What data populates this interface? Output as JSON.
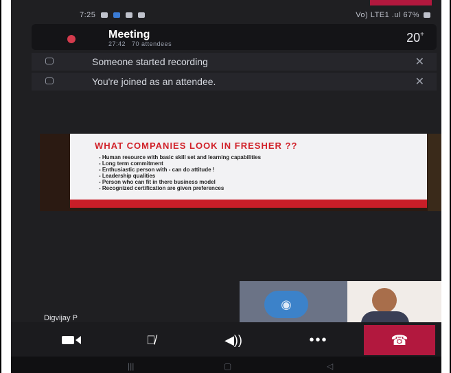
{
  "statusbar": {
    "time": "7:25",
    "right_text": "Vo) LTE1 .ul 67%"
  },
  "meeting": {
    "title": "Meeting",
    "duration": "27:42",
    "attendees": "70 attendees",
    "participant_count": "20",
    "participant_plus": "+"
  },
  "notifications": [
    {
      "text": "Someone started recording"
    },
    {
      "text": "You're joined as an attendee."
    }
  ],
  "slide": {
    "title": "WHAT COMPANIES LOOK IN FRESHER ??",
    "bullets": [
      "Human resource with basic skill set and learning capabilities",
      "Long term commitment",
      "Enthusiastic person with - can do attitude !",
      "Leadership qualities",
      "Person who can fit in there business model",
      "Recognized certification are given preferences"
    ]
  },
  "speaker": {
    "name": "Digvijay P"
  },
  "controls": {
    "camera_icon": "video-camera-off-icon",
    "mic_icon": "mic-off-icon",
    "speaker_icon": "speaker-icon",
    "more_icon": "more-options-icon",
    "hangup_icon": "hang-up-icon"
  },
  "colors": {
    "accent": "#b2183e",
    "recording": "#d43b4d",
    "background": "#1f1f22"
  }
}
